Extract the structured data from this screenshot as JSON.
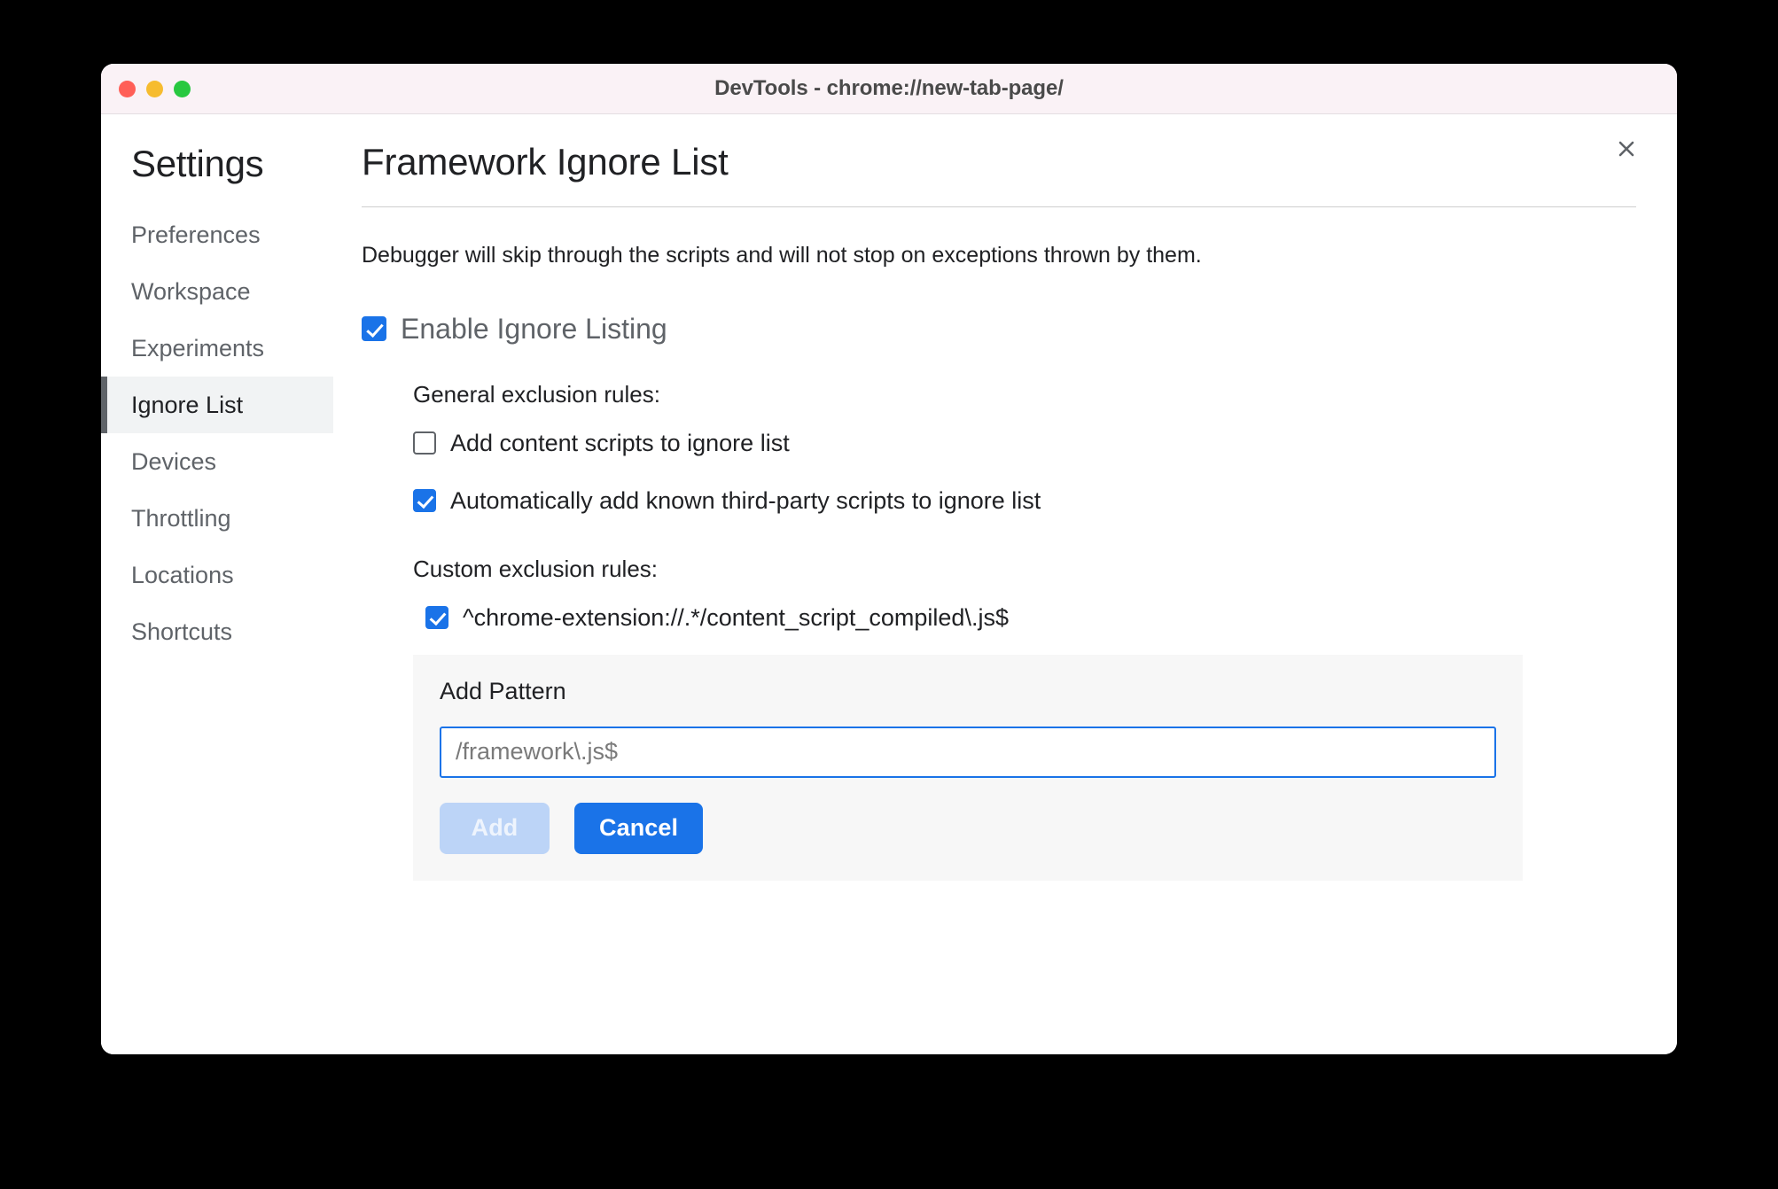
{
  "window": {
    "title": "DevTools - chrome://new-tab-page/",
    "traffic_lights": {
      "close": "close-window",
      "minimize": "minimize-window",
      "maximize": "maximize-window"
    },
    "close_dialog_label": "×"
  },
  "sidebar": {
    "title": "Settings",
    "items": [
      {
        "label": "Preferences",
        "selected": false
      },
      {
        "label": "Workspace",
        "selected": false
      },
      {
        "label": "Experiments",
        "selected": false
      },
      {
        "label": "Ignore List",
        "selected": true
      },
      {
        "label": "Devices",
        "selected": false
      },
      {
        "label": "Throttling",
        "selected": false
      },
      {
        "label": "Locations",
        "selected": false
      },
      {
        "label": "Shortcuts",
        "selected": false
      }
    ]
  },
  "main": {
    "title": "Framework Ignore List",
    "description": "Debugger will skip through the scripts and will not stop on exceptions thrown by them.",
    "enable_ignore_listing": {
      "label": "Enable Ignore Listing",
      "checked": true
    },
    "general_section": {
      "label": "General exclusion rules:",
      "rules": [
        {
          "label": "Add content scripts to ignore list",
          "checked": false
        },
        {
          "label": "Automatically add known third-party scripts to ignore list",
          "checked": true
        }
      ]
    },
    "custom_section": {
      "label": "Custom exclusion rules:",
      "patterns": [
        {
          "label": "^chrome-extension://.*/content_script_compiled\\.js$",
          "checked": true
        }
      ]
    },
    "add_pattern": {
      "title": "Add Pattern",
      "input_placeholder": "/framework\\.js$",
      "input_value": "",
      "add_label": "Add",
      "add_disabled": true,
      "cancel_label": "Cancel"
    }
  },
  "colors": {
    "accent": "#1a73e8",
    "accent_disabled": "#bcd4f7",
    "titlebar": "#faf2f6",
    "selected_row": "#f1f3f4",
    "card_bg": "#f7f7f7"
  }
}
